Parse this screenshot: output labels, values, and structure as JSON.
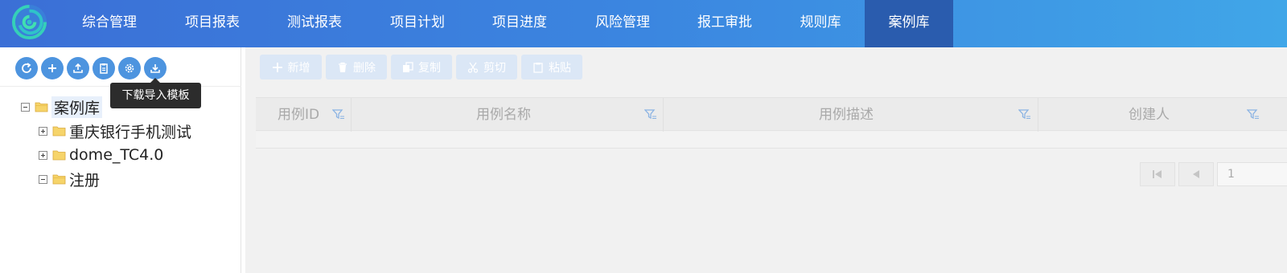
{
  "nav": {
    "items": [
      {
        "label": "综合管理"
      },
      {
        "label": "项目报表"
      },
      {
        "label": "测试报表"
      },
      {
        "label": "项目计划"
      },
      {
        "label": "项目进度"
      },
      {
        "label": "风险管理"
      },
      {
        "label": "报工审批"
      },
      {
        "label": "规则库"
      },
      {
        "label": "案例库",
        "active": true
      }
    ],
    "colors": {
      "gradient_start": "#3b6fd6",
      "gradient_end": "#40a6e8",
      "active": "#2a5cae"
    }
  },
  "left_toolbar": {
    "buttons": [
      "refresh-icon",
      "add-icon",
      "upload-icon",
      "clipboard-icon",
      "settings-icon",
      "download-icon"
    ],
    "tooltip": "下载导入模板"
  },
  "tree": {
    "root": {
      "label": "案例库",
      "expanded": true
    },
    "children": [
      {
        "label": "重庆银行手机测试",
        "expanded": false
      },
      {
        "label": "dome_TC4.0",
        "expanded": false
      },
      {
        "label": "注册",
        "expanded": true
      }
    ]
  },
  "toolbar": {
    "new_label": "新增",
    "delete_label": "删除",
    "copy_label": "复制",
    "cut_label": "剪切",
    "paste_label": "粘贴"
  },
  "grid": {
    "columns": [
      "用例ID",
      "用例名称",
      "用例描述",
      "创建人"
    ]
  },
  "pager": {
    "page": "1"
  }
}
